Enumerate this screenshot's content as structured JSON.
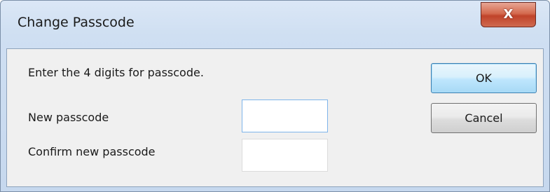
{
  "window": {
    "title": "Change Passcode",
    "close_glyph": "X"
  },
  "dialog": {
    "instruction": "Enter the 4 digits for passcode.",
    "new_passcode_label": "New passcode",
    "new_passcode_value": "",
    "confirm_passcode_label": "Confirm new passcode",
    "confirm_passcode_value": "",
    "ok_label": "OK",
    "cancel_label": "Cancel"
  },
  "colors": {
    "close_button": "#c0432a",
    "ok_button_border": "#3c7fb1",
    "focused_field_border": "#7eb4ea"
  },
  "icons": {
    "close": "close-icon"
  }
}
